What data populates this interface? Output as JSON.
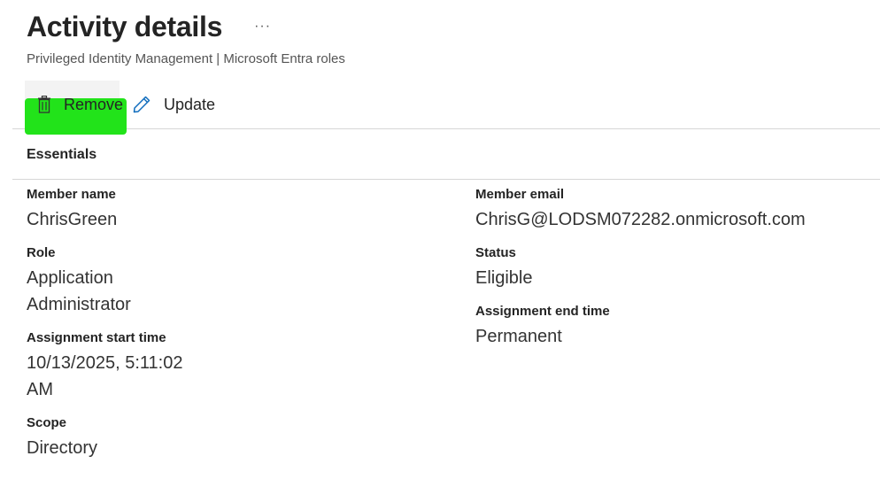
{
  "header": {
    "title": "Activity details",
    "more": "···",
    "subtitle": "Privileged Identity Management | Microsoft Entra roles"
  },
  "toolbar": {
    "remove_label": "Remove",
    "update_label": "Update"
  },
  "essentials": {
    "title": "Essentials",
    "member_name_label": "Member name",
    "member_name_value": "ChrisGreen",
    "role_label": "Role",
    "role_value_line1": "Application",
    "role_value_line2": "Administrator",
    "start_time_label": "Assignment start time",
    "start_time_line1": "10/13/2025, 5:11:02",
    "start_time_line2": "AM",
    "scope_label": "Scope",
    "scope_value": "Directory",
    "member_email_label": "Member email",
    "member_email_value": "ChrisG@LODSM072282.onmicrosoft.com",
    "status_label": "Status",
    "status_value": "Eligible",
    "end_time_label": "Assignment end time",
    "end_time_value": "Permanent"
  },
  "colors": {
    "highlight": "#22e31a",
    "icon_blue": "#0f6cbd"
  }
}
